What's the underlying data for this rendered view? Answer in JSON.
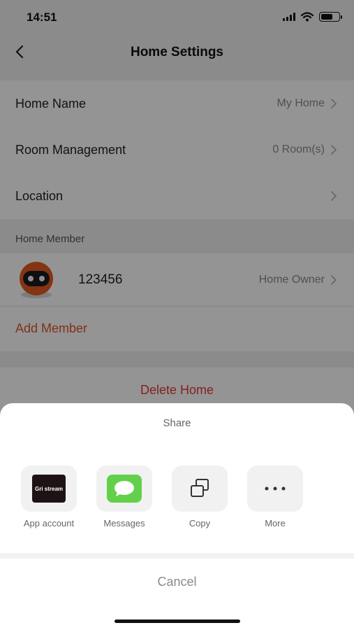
{
  "status_bar": {
    "time": "14:51"
  },
  "nav": {
    "title": "Home Settings",
    "back_icon": "chevron-left-icon"
  },
  "settings": {
    "rows": [
      {
        "label": "Home Name",
        "value": "My Home"
      },
      {
        "label": "Room Management",
        "value": "0 Room(s)"
      },
      {
        "label": "Location",
        "value": ""
      }
    ]
  },
  "members": {
    "section_label": "Home Member",
    "member": {
      "name": "123456",
      "role": "Home Owner"
    },
    "add_label": "Add Member"
  },
  "delete_label": "Delete Home",
  "share_sheet": {
    "title": "Share",
    "items": [
      {
        "label": "App account",
        "logo_text": "Gri  stream"
      },
      {
        "label": "Messages"
      },
      {
        "label": "Copy"
      },
      {
        "label": "More"
      }
    ],
    "cancel_label": "Cancel"
  },
  "colors": {
    "accent": "#e0542a",
    "danger": "#e63a3a",
    "messages_green": "#62d04a"
  }
}
